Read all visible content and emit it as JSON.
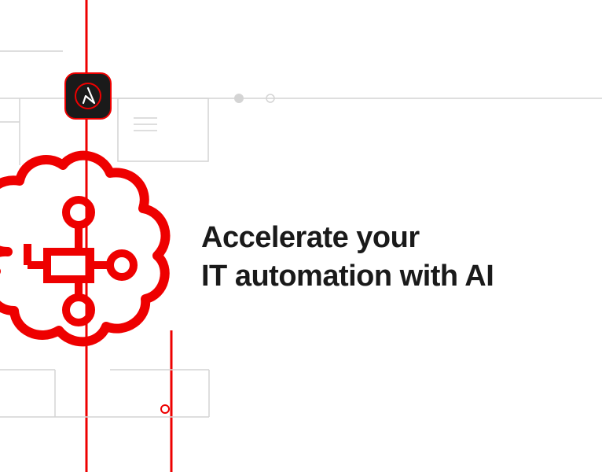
{
  "headline": {
    "line1": "Accelerate your",
    "line2": "IT automation with AI"
  },
  "icons": {
    "ansible": "ansible-icon",
    "brain": "brain-ai-icon"
  },
  "colors": {
    "accent": "#ee0000",
    "text": "#1a1a1a",
    "line": "#d4d4d4"
  }
}
